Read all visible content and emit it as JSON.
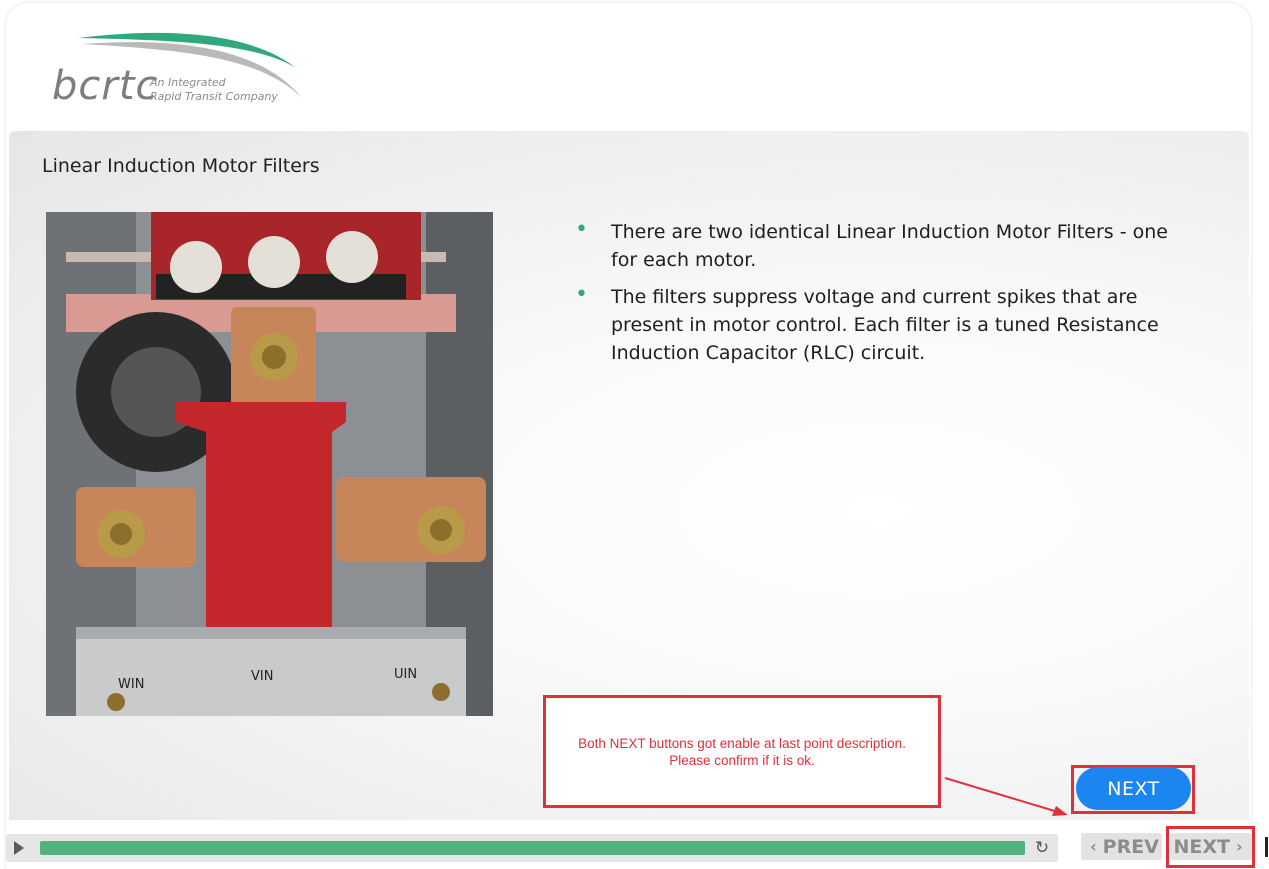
{
  "logo": {
    "wordmark": "bcrtc",
    "tagline_line1": "An Integrated",
    "tagline_line2": "Rapid Transit Company"
  },
  "slide": {
    "title": "Linear Induction Motor Filters",
    "bullets": [
      "There are two identical Linear Induction Motor Filters - one for each motor.",
      "The filters suppress voltage and current spikes that are present in motor control. Each filter is a tuned Resistance Induction Capacitor (RLC) circuit."
    ],
    "photo_labels": [
      "WIN",
      "VIN",
      "UIN"
    ],
    "next_label": "NEXT"
  },
  "review_note": {
    "line1": "Both NEXT buttons got enable at last point description.",
    "line2": "Please confirm if it is ok."
  },
  "player": {
    "progress_percent": 100,
    "play_icon": "play-icon",
    "replay_icon": "replay-icon",
    "prev_label": "PREV",
    "next_label": "NEXT"
  },
  "colors": {
    "brand_green": "#3aa776",
    "progress_green": "#52b27f",
    "next_blue": "#1b85f0",
    "annotation_red": "#e0303a"
  }
}
